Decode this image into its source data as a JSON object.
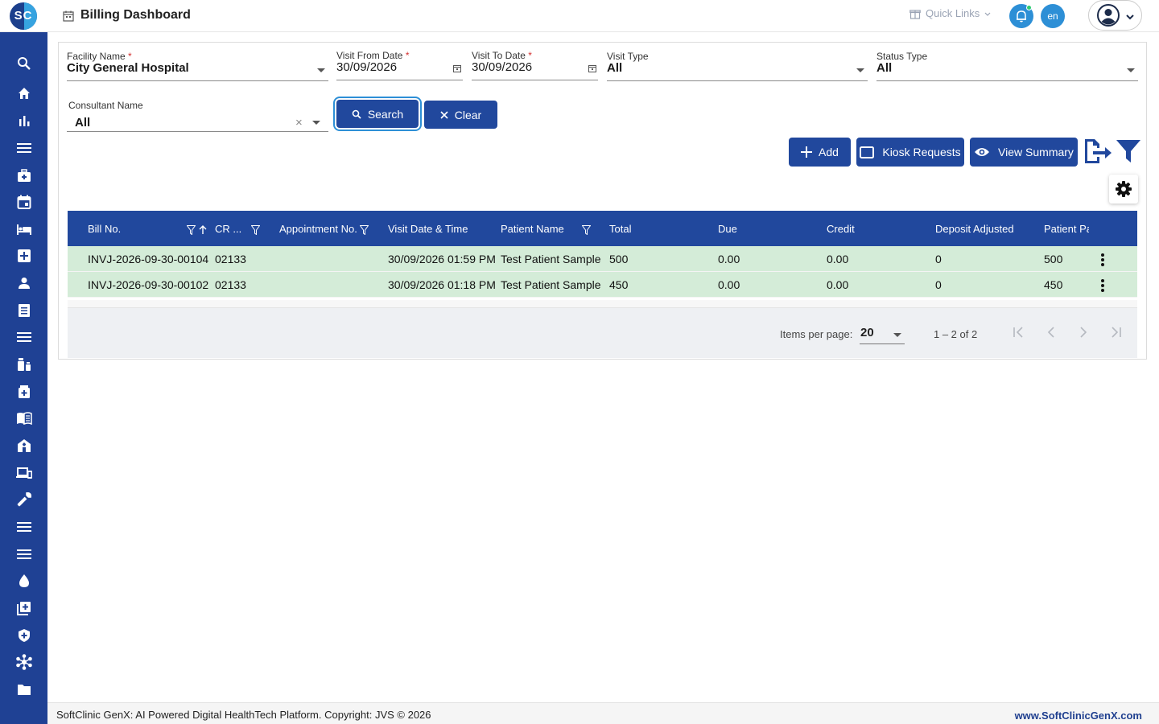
{
  "app": {
    "logo_text": "SC",
    "title": "Billing Dashboard"
  },
  "header": {
    "quick_links": "Quick Links",
    "lang": "en"
  },
  "sidebar": {
    "items": [
      "search-icon",
      "home-icon",
      "bar-chart-icon",
      "menu-icon",
      "medical-bag-icon",
      "calendar-icon",
      "bed-icon",
      "hospital-plus-icon",
      "person-icon",
      "notes-icon",
      "list-icon",
      "medication-icon",
      "medicine-box-icon",
      "book-icon",
      "hospital-building-icon",
      "devices-icon",
      "wrench-icon",
      "list-icon",
      "list-icon",
      "drop-icon",
      "add-box-icon",
      "shield-icon",
      "hub-icon",
      "folder-icon"
    ]
  },
  "filters": {
    "facility": {
      "label": "Facility Name",
      "value": "City General Hospital"
    },
    "visit_from": {
      "label": "Visit From Date",
      "value": "30/09/2026"
    },
    "visit_to": {
      "label": "Visit To Date",
      "value": "30/09/2026"
    },
    "visit_type": {
      "label": "Visit Type",
      "value": "All"
    },
    "status_type": {
      "label": "Status Type",
      "value": "All"
    },
    "consultant": {
      "label": "Consultant Name",
      "value": "All"
    },
    "required_mark": "*",
    "clear_x": "×"
  },
  "buttons": {
    "search": "Search",
    "clear": "Clear",
    "add": "Add",
    "kiosk": "Kiosk Requests",
    "summary": "View Summary"
  },
  "table": {
    "columns": [
      "Bill No.",
      "CR ...",
      "Appointment No.",
      "Visit Date & Time",
      "Patient Name",
      "Total",
      "Due",
      "Credit",
      "Deposit Adjusted",
      "Patient Pa"
    ],
    "rows": [
      [
        "INVJ-2026-09-30-00104",
        "02133",
        "",
        "30/09/2026 01:59 PM",
        "Test Patient Sample",
        "500",
        "0.00",
        "0.00",
        "0",
        "500"
      ],
      [
        "INVJ-2026-09-30-00102",
        "02133",
        "",
        "30/09/2026 01:18 PM",
        "Test Patient Sample",
        "450",
        "0.00",
        "0.00",
        "0",
        "450"
      ]
    ]
  },
  "paginator": {
    "items_per_page_label": "Items per page:",
    "page_size": "20",
    "range": "1 – 2 of 2"
  },
  "footer": {
    "copyright": "SoftClinic GenX: AI Powered Digital HealthTech Platform. Copyright: JVS © 2026",
    "website": "www.SoftClinicGenX.com"
  },
  "colors": {
    "primary": "#21489d",
    "sidebar": "#1f4194",
    "row_bg": "#d4ecd8",
    "accent": "#2d8fd6"
  }
}
